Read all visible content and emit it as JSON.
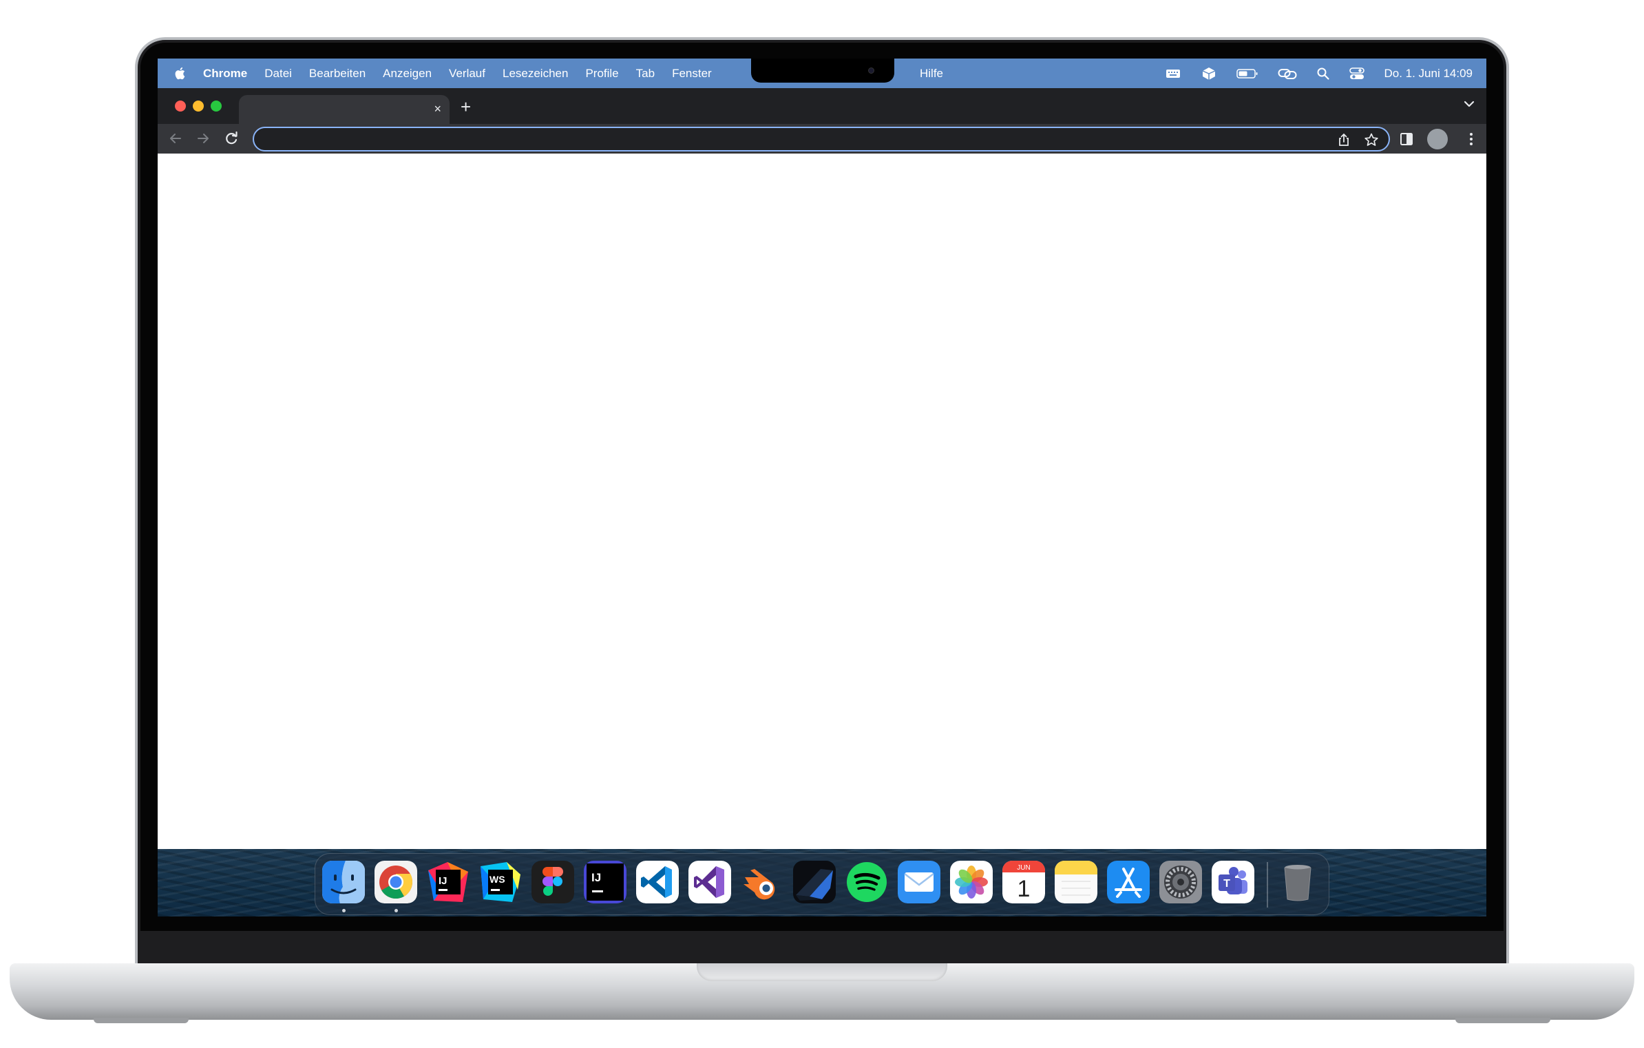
{
  "menubar": {
    "app_name": "Chrome",
    "menus": [
      "Datei",
      "Bearbeiten",
      "Anzeigen",
      "Verlauf",
      "Lesezeichen",
      "Profile",
      "Tab",
      "Fenster"
    ],
    "help": "Hilfe",
    "clock": "Do. 1. Juni  14:09",
    "status_icons": [
      "keyboard-icon",
      "cube-icon",
      "battery-icon",
      "link-icon",
      "search-icon",
      "control-center-icon"
    ]
  },
  "browser": {
    "tab_title": "",
    "close_glyph": "×",
    "new_tab_glyph": "+",
    "address_value": "",
    "accent_color": "#8ab4f8",
    "window_controls": [
      "#ff5f57",
      "#febc2e",
      "#28c840"
    ]
  },
  "dock": {
    "apps": [
      {
        "icon": "finder-icon",
        "running": true
      },
      {
        "icon": "chrome-icon",
        "running": true
      },
      {
        "icon": "intellij-idea-icon",
        "running": false
      },
      {
        "icon": "webstorm-icon",
        "running": false
      },
      {
        "icon": "figma-icon",
        "running": false
      },
      {
        "icon": "intellij-dark-icon",
        "running": false
      },
      {
        "icon": "vscode-icon",
        "running": false
      },
      {
        "icon": "visual-studio-icon",
        "running": false
      },
      {
        "icon": "blender-icon",
        "running": false
      },
      {
        "icon": "app-icon",
        "running": false
      },
      {
        "icon": "spotify-icon",
        "running": false
      },
      {
        "icon": "mail-icon",
        "running": false
      },
      {
        "icon": "photos-icon",
        "running": false
      },
      {
        "icon": "calendar-icon",
        "running": false
      },
      {
        "icon": "notes-icon",
        "running": false
      },
      {
        "icon": "app-store-icon",
        "running": false
      },
      {
        "icon": "system-settings-icon",
        "running": false
      },
      {
        "icon": "teams-icon",
        "running": false
      },
      {
        "icon": "trash-icon",
        "running": false
      }
    ],
    "labels": {
      "intellij": "IJ",
      "webstorm": "WS",
      "intellij_dark": "IJ",
      "calendar_month": "JUN",
      "calendar_day": "1",
      "teams": "T"
    }
  }
}
